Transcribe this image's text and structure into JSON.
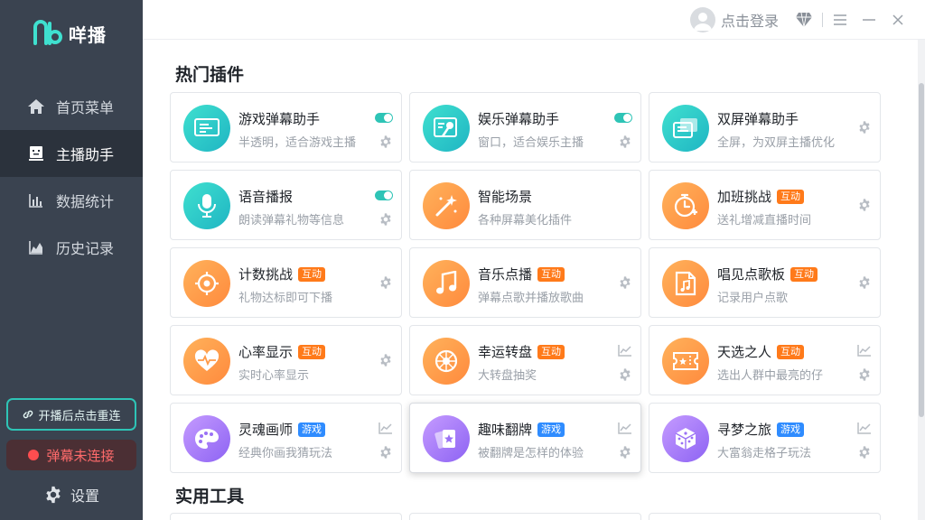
{
  "brand": {
    "name": "咩播"
  },
  "sidebar": {
    "items": [
      {
        "label": "首页菜单",
        "icon": "home-icon",
        "active": false
      },
      {
        "label": "主播助手",
        "icon": "robot-icon",
        "active": true
      },
      {
        "label": "数据统计",
        "icon": "bar-chart-icon",
        "active": false
      },
      {
        "label": "历史记录",
        "icon": "area-chart-icon",
        "active": false
      }
    ],
    "reconnect_label": "开播后点击重连",
    "danmu_status": "弹幕未连接",
    "settings_label": "设置"
  },
  "topbar": {
    "login_label": "点击登录"
  },
  "sections": {
    "hot_plugins": "热门插件",
    "tools": "实用工具"
  },
  "cards": [
    {
      "title": "游戏弹幕助手",
      "desc": "半透明，适合游戏主播",
      "badge": "",
      "toggle": true,
      "icon": "danmu-screen-icon",
      "color": "teal"
    },
    {
      "title": "娱乐弹幕助手",
      "desc": "窗口，适合娱乐主播",
      "badge": "",
      "toggle": true,
      "icon": "mic-note-icon",
      "color": "teal"
    },
    {
      "title": "双屏弹幕助手",
      "desc": "全屏，为双屏主播优化",
      "badge": "",
      "toggle": false,
      "icon": "dual-screen-icon",
      "color": "teal"
    },
    {
      "title": "语音播报",
      "desc": "朗读弹幕礼物等信息",
      "badge": "",
      "toggle": true,
      "icon": "microphone-icon",
      "color": "teal"
    },
    {
      "title": "智能场景",
      "desc": "各种屏幕美化插件",
      "badge": "",
      "toggle": false,
      "icon": "magic-wand-icon",
      "color": "orange"
    },
    {
      "title": "加班挑战",
      "desc": "送礼增减直播时间",
      "badge": "互动",
      "badge_color": "orange",
      "toggle": false,
      "icon": "stopwatch-icon",
      "color": "orange"
    },
    {
      "title": "计数挑战",
      "desc": "礼物达标即可下播",
      "badge": "互动",
      "badge_color": "orange",
      "toggle": false,
      "icon": "target-icon",
      "color": "orange"
    },
    {
      "title": "音乐点播",
      "desc": "弹幕点歌并播放歌曲",
      "badge": "互动",
      "badge_color": "orange",
      "toggle": false,
      "icon": "music-note-icon",
      "color": "orange"
    },
    {
      "title": "唱见点歌板",
      "desc": "记录用户点歌",
      "badge": "互动",
      "badge_color": "orange",
      "toggle": false,
      "icon": "song-sheet-icon",
      "color": "orange"
    },
    {
      "title": "心率显示",
      "desc": "实时心率显示",
      "badge": "互动",
      "badge_color": "orange",
      "toggle": false,
      "icon": "heart-rate-icon",
      "color": "orange",
      "chart": false
    },
    {
      "title": "幸运转盘",
      "desc": "大转盘抽奖",
      "badge": "互动",
      "badge_color": "orange",
      "toggle": false,
      "icon": "wheel-icon",
      "color": "orange",
      "chart": true
    },
    {
      "title": "天选之人",
      "desc": "选出人群中最亮的仔",
      "badge": "互动",
      "badge_color": "orange",
      "toggle": false,
      "icon": "ticket-icon",
      "color": "orange",
      "chart": true
    },
    {
      "title": "灵魂画师",
      "desc": "经典你画我猜玩法",
      "badge": "游戏",
      "badge_color": "blue",
      "toggle": false,
      "icon": "palette-icon",
      "color": "purple",
      "chart": true
    },
    {
      "title": "趣味翻牌",
      "desc": "被翻牌是怎样的体验",
      "badge": "游戏",
      "badge_color": "blue",
      "toggle": false,
      "icon": "cards-icon",
      "color": "purple",
      "chart": true
    },
    {
      "title": "寻梦之旅",
      "desc": "大富翁走格子玩法",
      "badge": "游戏",
      "badge_color": "blue",
      "toggle": false,
      "icon": "dice-icon",
      "color": "purple",
      "chart": true
    }
  ],
  "colors": {
    "sidebar_bg": "#3a4350",
    "accent": "#2ec4b6",
    "orange_badge": "#ff7a1a",
    "blue_badge": "#2f8cff"
  }
}
